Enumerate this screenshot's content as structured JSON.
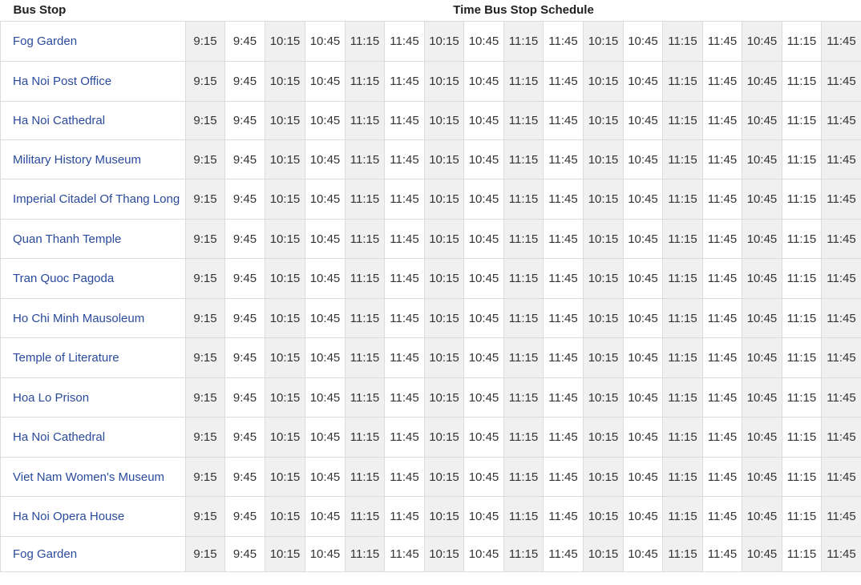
{
  "header": {
    "stop_label": "Bus Stop",
    "schedule_label": "Time Bus Stop Schedule"
  },
  "times": [
    "9:15",
    "9:45",
    "10:15",
    "10:45",
    "11:15",
    "11:45",
    "10:15",
    "10:45",
    "11:15",
    "11:45",
    "10:15",
    "10:45",
    "11:15",
    "11:45",
    "10:45",
    "11:15",
    "11:45"
  ],
  "stops": [
    "Fog Garden",
    "Ha Noi Post Office",
    "Ha Noi Cathedral",
    "Military History Museum",
    "Imperial Citadel Of Thang Long",
    "Quan Thanh Temple",
    "Tran Quoc Pagoda",
    "Ho Chi Minh Mausoleum",
    "Temple of Literature",
    "Hoa Lo Prison",
    "Ha Noi Cathedral",
    "Viet Nam Women's Museum",
    "Ha Noi Opera House",
    "Fog Garden"
  ],
  "colors": {
    "stop_link": "#2a4a9c",
    "shaded_cell": "#f0f0f0",
    "border": "#dcdcdc"
  }
}
